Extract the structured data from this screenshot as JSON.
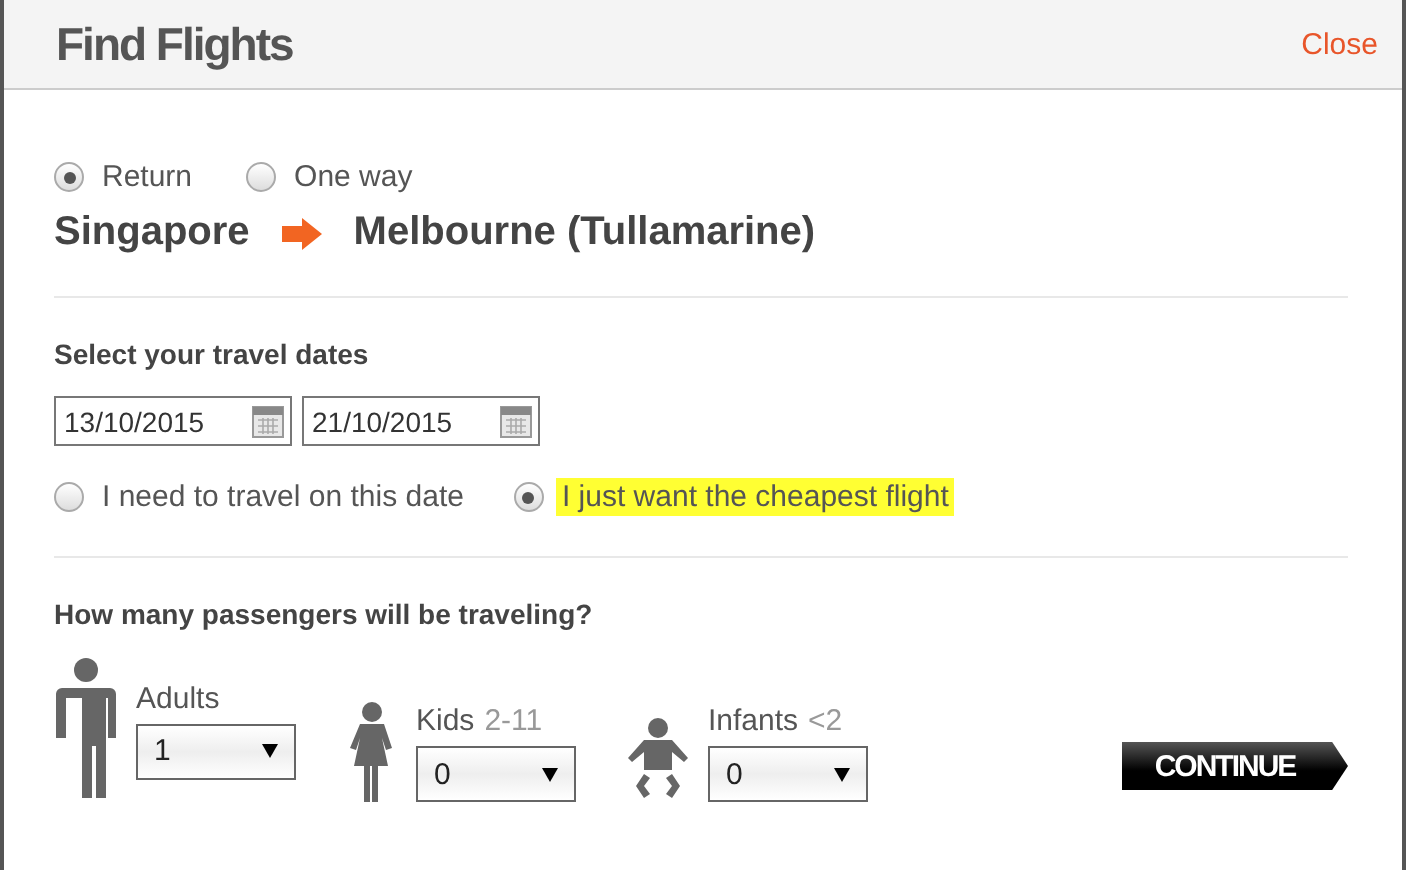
{
  "dialog": {
    "title": "Find Flights",
    "close": "Close"
  },
  "trip_types": [
    {
      "label": "Return",
      "selected": true
    },
    {
      "label": "One way",
      "selected": false
    }
  ],
  "route": {
    "origin": "Singapore",
    "destination": "Melbourne (Tullamarine)"
  },
  "dates": {
    "heading": "Select your travel dates",
    "fields": [
      {
        "value": "13/10/2015"
      },
      {
        "value": "21/10/2015"
      }
    ],
    "flexibility": [
      {
        "label": "I need to travel on this date",
        "selected": false,
        "highlighted": false
      },
      {
        "label": "I just want the cheapest flight",
        "selected": true,
        "highlighted": true
      }
    ]
  },
  "passengers": {
    "heading": "How many passengers will be traveling?",
    "types": [
      {
        "kind": "adult",
        "label": "Adults",
        "value": "1"
      },
      {
        "kind": "kid",
        "label": "Kids",
        "age": "2-11",
        "value": "0"
      },
      {
        "kind": "infant",
        "label": "Infants",
        "age": "<2",
        "value": "0"
      }
    ]
  },
  "continue_button": "CONTINUE"
}
